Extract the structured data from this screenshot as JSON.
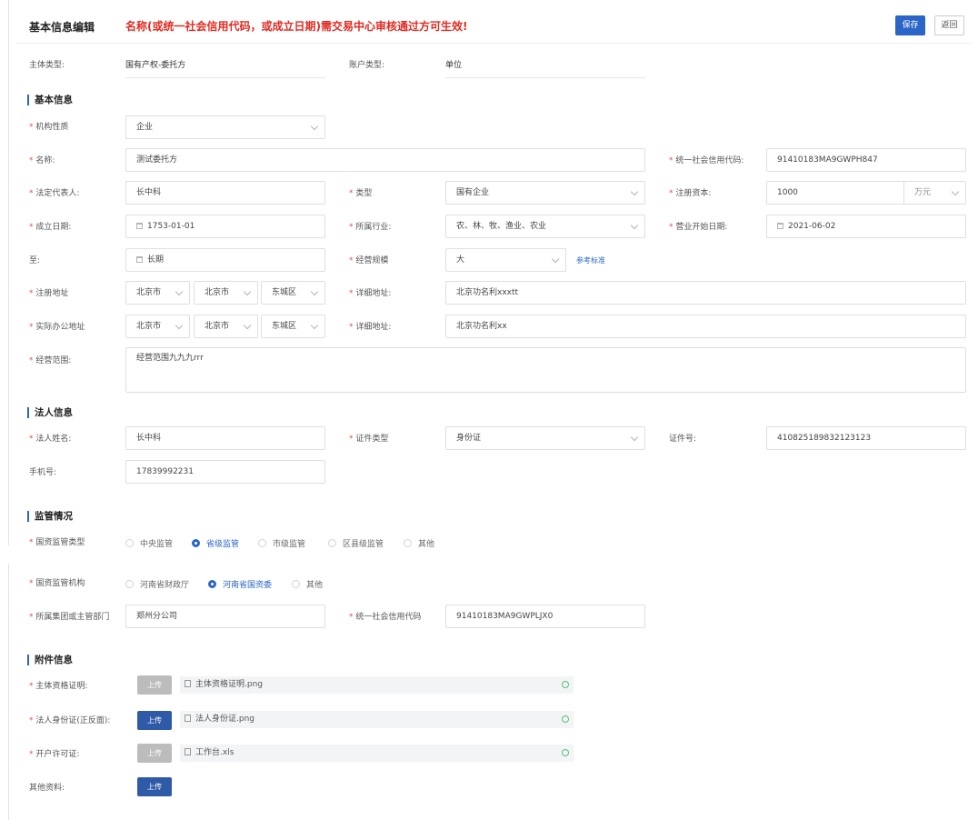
{
  "header": {
    "title": "基本信息编辑",
    "notice": "名称(或统一社会信用代码，或成立日期)需交易中心审核通过方可生效!",
    "save_label": "保存",
    "back_label": "返回"
  },
  "top": {
    "subject_type_label": "主体类型:",
    "subject_type_value": "国有产权-委托方",
    "account_type_label": "账户类型:",
    "account_type_value": "单位"
  },
  "basic": {
    "section_title": "基本信息",
    "org_nature_label": "机构性质",
    "org_nature_value": "企业",
    "name_label": "名称:",
    "name_value": "测试委托方",
    "credit_code_label": "统一社会信用代码:",
    "credit_code_value": "91410183MA9GWPH847",
    "legal_rep_label": "法定代表人:",
    "legal_rep_value": "长中科",
    "type_label": "类型",
    "type_value": "国有企业",
    "reg_capital_label": "注册资本:",
    "reg_capital_value": "1000",
    "reg_capital_unit": "万元",
    "found_date_label": "成立日期:",
    "found_date_value": "1753-01-01",
    "industry_label": "所属行业:",
    "industry_value": "农、林、牧、渔业、农业",
    "biz_start_label": "营业开始日期:",
    "biz_start_value": "2021-06-02",
    "to_label": "至:",
    "to_value": "长期",
    "scale_label": "经营规模",
    "scale_value": "大",
    "ref_link": "参考标准",
    "reg_addr_label": "注册地址",
    "reg_province": "北京市",
    "reg_city": "北京市",
    "reg_district": "东城区",
    "detail_addr_label": "详细地址:",
    "reg_detail": "北京功名利xxxtt",
    "office_addr_label": "实际办公地址",
    "office_province": "北京市",
    "office_city": "北京市",
    "office_district": "东城区",
    "office_detail": "北京功名利xx",
    "scope_label": "经营范围:",
    "scope_value": "经营范围九九九rrr"
  },
  "legal": {
    "section_title": "法人信息",
    "name_label": "法人姓名:",
    "name_value": "长中科",
    "id_type_label": "证件类型",
    "id_type_value": "身份证",
    "id_no_label": "证件号:",
    "id_no_value": "410825189832123123",
    "phone_label": "手机号:",
    "phone_value": "17839992231"
  },
  "supervision": {
    "section_title": "监管情况",
    "type_label": "国资监管类型",
    "type_options": [
      "中央监管",
      "省级监管",
      "市级监管",
      "区县级监管",
      "其他"
    ],
    "org_label": "国资监管机构",
    "org_options": [
      "河南省财政厅",
      "河南省国资委",
      "其他"
    ],
    "group_label": "所属集团或主管部门",
    "group_value": "郑州分公司",
    "group_code_label": "统一社会信用代码",
    "group_code_value": "91410183MA9GWPLJX0"
  },
  "attachments": {
    "section_title": "附件信息",
    "upload_label": "上传",
    "subject_cert_label": "主体资格证明:",
    "subject_cert_file": "主体资格证明.png",
    "legal_id_label": "法人身份证(正反面):",
    "legal_id_file": "法人身份证.png",
    "license_label": "开户许可证:",
    "license_file": "工作台.xls",
    "other_label": "其他资料:"
  },
  "colors": {
    "primary": "#2a65c7",
    "notice": "#e02b22",
    "required": "#e5533e",
    "success": "#5bbf78"
  }
}
